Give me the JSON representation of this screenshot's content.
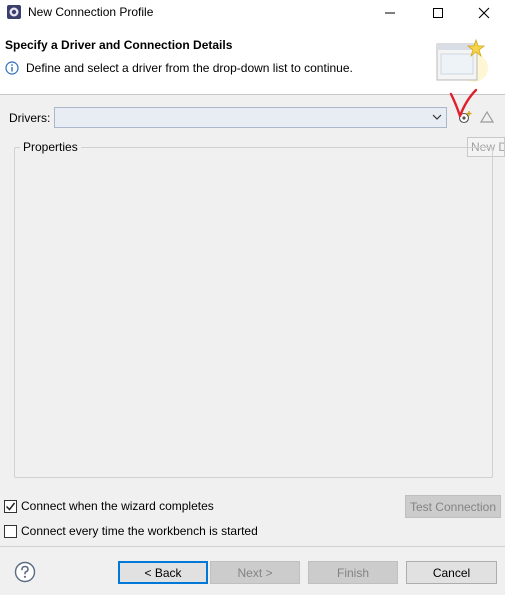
{
  "window": {
    "title": "New Connection Profile",
    "controls": {
      "minimize": "—",
      "maximize": "☐",
      "close": "✕"
    }
  },
  "banner": {
    "title": "Specify a Driver and Connection Details",
    "description": "Define and select a driver from the drop-down list to continue."
  },
  "drivers": {
    "label": "Drivers:",
    "selected": "",
    "new_driver_tooltip": "New Driver Definition"
  },
  "properties": {
    "label": "Properties"
  },
  "options": {
    "connect_when_complete": {
      "label": "Connect when the wizard completes",
      "checked": true
    },
    "connect_every_startup": {
      "label": "Connect every time the workbench is started",
      "checked": false
    }
  },
  "buttons": {
    "test_connection": "Test Connection",
    "back": "< Back",
    "next": "Next >",
    "finish": "Finish",
    "cancel": "Cancel"
  },
  "colors": {
    "dialog_bg": "#f0f0f0",
    "accent": "#0078d7",
    "annotation_mark": "#e0202a"
  }
}
